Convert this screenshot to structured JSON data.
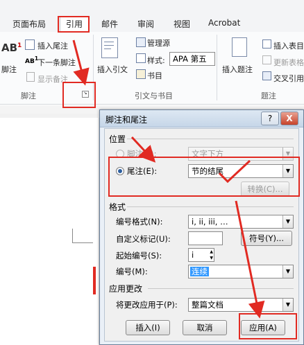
{
  "tabs": [
    {
      "label": "页面布局"
    },
    {
      "label": "引用"
    },
    {
      "label": "邮件"
    },
    {
      "label": "审阅"
    },
    {
      "label": "视图"
    },
    {
      "label": "Acrobat"
    }
  ],
  "ribbon": {
    "insert_footnote_big": "脚注",
    "insert_endnote": "插入尾注",
    "next_footnote": "下一条脚注",
    "show_notes": "显示备注",
    "group_footnotes": "脚注",
    "insert_citation": "插入引文",
    "manage_sources": "管理源",
    "style_label": "样式:",
    "style_value": "APA 第五",
    "bibliography": "书目",
    "group_citations": "引文与书目",
    "insert_caption": "插入题注",
    "insert_table_figures": "插入表目",
    "update_table": "更新表格",
    "cross_reference": "交叉引用",
    "group_captions": "题注"
  },
  "dialog": {
    "title": "脚注和尾注",
    "help_btn": "?",
    "close_btn": "X",
    "location_heading": "位置",
    "footnote_label": "脚注(F):",
    "footnote_value": "文字下方",
    "endnote_label": "尾注(E):",
    "endnote_value": "节的结尾",
    "convert_btn": "转换(C)...",
    "format_heading": "格式",
    "number_format_label": "编号格式(N):",
    "number_format_value": "i, ii, iii, …",
    "custom_mark_label": "自定义标记(U):",
    "custom_mark_value": "",
    "symbol_btn": "符号(Y)...",
    "start_at_label": "起始编号(S):",
    "start_at_value": "i",
    "numbering_label": "编号(M):",
    "numbering_value": "连续",
    "apply_changes_heading": "应用更改",
    "apply_to_label": "将更改应用于(P):",
    "apply_to_value": "整篇文档",
    "insert_btn": "插入(I)",
    "cancel_btn": "取消",
    "apply_btn": "应用(A)"
  },
  "colors": {
    "annotation_red": "#e12a22",
    "accent_blue": "#2c5e9e"
  }
}
